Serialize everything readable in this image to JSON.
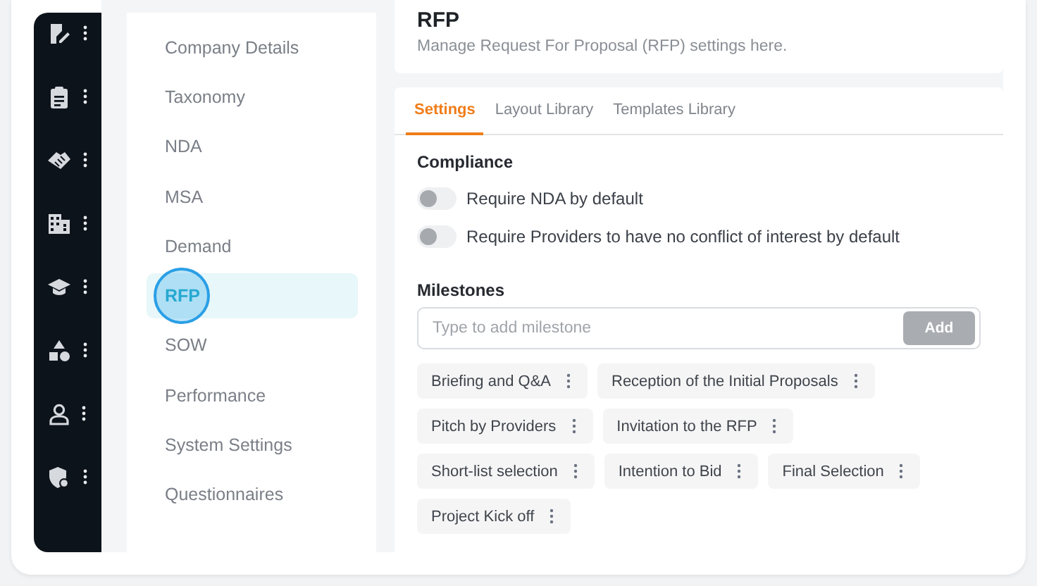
{
  "icon_rail": {
    "items": [
      {
        "kind": "edit"
      },
      {
        "kind": "clipboard"
      },
      {
        "kind": "handshake"
      },
      {
        "kind": "building"
      },
      {
        "kind": "cap"
      },
      {
        "kind": "shapes"
      },
      {
        "kind": "person"
      },
      {
        "kind": "shield"
      }
    ]
  },
  "settings_nav": {
    "items": [
      {
        "label": "Company Details",
        "selected": false
      },
      {
        "label": "Taxonomy",
        "selected": false
      },
      {
        "label": "NDA",
        "selected": false
      },
      {
        "label": "MSA",
        "selected": false
      },
      {
        "label": "Demand",
        "selected": false
      },
      {
        "label": "RFP",
        "selected": true
      },
      {
        "label": "SOW",
        "selected": false
      },
      {
        "label": "Performance",
        "selected": false
      },
      {
        "label": "System Settings",
        "selected": false
      },
      {
        "label": "Questionnaires",
        "selected": false
      }
    ]
  },
  "header": {
    "title": "RFP",
    "subtitle": "Manage Request For Proposal (RFP) settings here."
  },
  "tabs": [
    {
      "label": "Settings",
      "selected": true
    },
    {
      "label": "Layout Library",
      "selected": false
    },
    {
      "label": "Templates Library",
      "selected": false
    }
  ],
  "compliance": {
    "title": "Compliance",
    "toggles": [
      {
        "label": "Require NDA by default",
        "on": false
      },
      {
        "label": "Require Providers to have no conflict of interest by default",
        "on": false
      }
    ]
  },
  "milestones": {
    "title": "Milestones",
    "placeholder": "Type to add milestone",
    "add_button": "Add",
    "items": [
      "Briefing and Q&A",
      "Reception of the Initial Proposals",
      "Pitch by Providers",
      "Invitation to the RFP",
      "Short-list selection",
      "Intention to Bid",
      "Final Selection",
      "Project Kick off"
    ]
  }
}
